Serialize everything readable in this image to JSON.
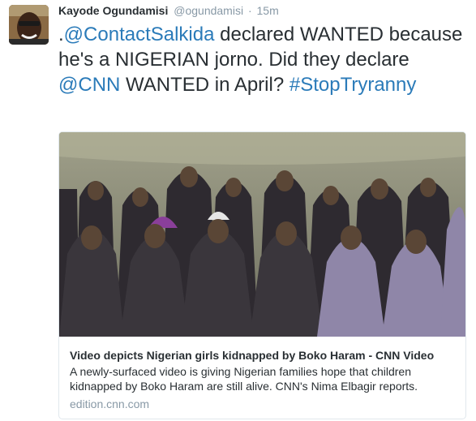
{
  "author": {
    "name": "Kayode Ogundamisi",
    "handle": "@ogundamisi",
    "separator": "·",
    "time": "15m",
    "avatar_icon": "user-avatar-photo"
  },
  "tweet": {
    "prefix": ".",
    "mention_1": "@ContactSalkida",
    "text_1": " declared WANTED because he's a NIGERIAN jorno. Did they declare ",
    "mention_2": "@CNN",
    "text_2": " WANTED in April? ",
    "hashtag": "#StopTryranny"
  },
  "card": {
    "image_icon": "video-thumbnail-photo",
    "title": "Video depicts Nigerian girls kidnapped by Boko Haram - CNN Video",
    "description": "A newly-surfaced video is giving Nigerian families hope that children kidnapped by Boko Haram are still alive. CNN's Nima Elbagir reports.",
    "domain": "edition.cnn.com"
  },
  "colors": {
    "link": "#2b7bb9",
    "text": "#292f33",
    "muted": "#8899a6",
    "border": "#e1e8ed"
  }
}
